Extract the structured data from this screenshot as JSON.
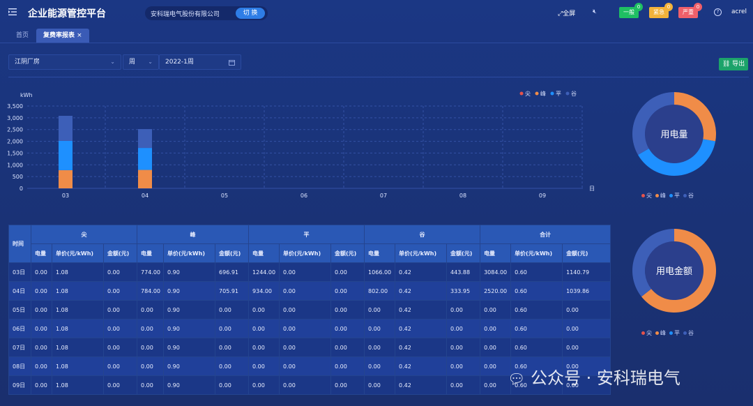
{
  "header": {
    "title": "企业能源管控平台",
    "company": "安科瑞电气股份有限公司",
    "switch_label": "切 换",
    "fullscreen_label": "全屏",
    "badges": [
      {
        "label": "一般",
        "count": "0",
        "color": "#1fbf63",
        "count_color": "#1fbf63"
      },
      {
        "label": "紧急",
        "count": "0",
        "color": "#f2b23a",
        "count_color": "#f2b23a"
      },
      {
        "label": "严重",
        "count": "0",
        "color": "#f0606a",
        "count_color": "#f0606a"
      }
    ],
    "username": "acrel"
  },
  "tabs": [
    {
      "label": "首页",
      "active": false
    },
    {
      "label": "复费率报表",
      "active": true
    }
  ],
  "filters": {
    "site": "江阴厂房",
    "period": "周",
    "date": "2022-1周"
  },
  "export_label": "导出",
  "legend": [
    {
      "name": "尖",
      "color": "#e5534b"
    },
    {
      "name": "峰",
      "color": "#f08c48"
    },
    {
      "name": "平",
      "color": "#1e90ff"
    },
    {
      "name": "谷",
      "color": "#3d5fb8"
    }
  ],
  "chart_data": [
    {
      "type": "bar",
      "stacked": true,
      "title": "",
      "ylabel": "kWh",
      "xlabel": "日",
      "ylim": [
        0,
        3500
      ],
      "yticks": [
        "0",
        "500",
        "1,000",
        "1,500",
        "2,000",
        "2,500",
        "3,000",
        "3,500"
      ],
      "categories": [
        "03",
        "04",
        "05",
        "06",
        "07",
        "08",
        "09"
      ],
      "series": [
        {
          "name": "尖",
          "color": "#e5534b",
          "values": [
            0,
            0,
            0,
            0,
            0,
            0,
            0
          ]
        },
        {
          "name": "峰",
          "color": "#f08c48",
          "values": [
            774,
            784,
            0,
            0,
            0,
            0,
            0
          ]
        },
        {
          "name": "平",
          "color": "#1e90ff",
          "values": [
            1244,
            934,
            0,
            0,
            0,
            0,
            0
          ]
        },
        {
          "name": "谷",
          "color": "#3d5fb8",
          "values": [
            1066,
            802,
            0,
            0,
            0,
            0,
            0
          ]
        }
      ],
      "legend_position": "top-right",
      "grid": true
    },
    {
      "type": "pie",
      "title": "用电量",
      "labels": [
        "尖",
        "峰",
        "平",
        "谷"
      ],
      "values": [
        0,
        1558,
        2178,
        1868
      ],
      "colors": [
        "#e5534b",
        "#f08c48",
        "#1e90ff",
        "#3d5fb8"
      ]
    },
    {
      "type": "pie",
      "title": "用电金额",
      "labels": [
        "尖",
        "峰",
        "平",
        "谷"
      ],
      "values": [
        0,
        1402.82,
        0,
        777.83
      ],
      "colors": [
        "#e5534b",
        "#f08c48",
        "#1e90ff",
        "#3d5fb8"
      ]
    }
  ],
  "table": {
    "time_header": "时间",
    "groups": [
      "尖",
      "峰",
      "平",
      "谷",
      "合计"
    ],
    "sub_headers": [
      "电量",
      "单价(元/kWh)",
      "金额(元)"
    ],
    "rows": [
      [
        "03日",
        "0.00",
        "1.08",
        "0.00",
        "774.00",
        "0.90",
        "696.91",
        "1244.00",
        "0.00",
        "0.00",
        "1066.00",
        "0.42",
        "443.88",
        "3084.00",
        "0.60",
        "1140.79"
      ],
      [
        "04日",
        "0.00",
        "1.08",
        "0.00",
        "784.00",
        "0.90",
        "705.91",
        "934.00",
        "0.00",
        "0.00",
        "802.00",
        "0.42",
        "333.95",
        "2520.00",
        "0.60",
        "1039.86"
      ],
      [
        "05日",
        "0.00",
        "1.08",
        "0.00",
        "0.00",
        "0.90",
        "0.00",
        "0.00",
        "0.00",
        "0.00",
        "0.00",
        "0.42",
        "0.00",
        "0.00",
        "0.60",
        "0.00"
      ],
      [
        "06日",
        "0.00",
        "1.08",
        "0.00",
        "0.00",
        "0.90",
        "0.00",
        "0.00",
        "0.00",
        "0.00",
        "0.00",
        "0.42",
        "0.00",
        "0.00",
        "0.60",
        "0.00"
      ],
      [
        "07日",
        "0.00",
        "1.08",
        "0.00",
        "0.00",
        "0.90",
        "0.00",
        "0.00",
        "0.00",
        "0.00",
        "0.00",
        "0.42",
        "0.00",
        "0.00",
        "0.60",
        "0.00"
      ],
      [
        "08日",
        "0.00",
        "1.08",
        "0.00",
        "0.00",
        "0.90",
        "0.00",
        "0.00",
        "0.00",
        "0.00",
        "0.00",
        "0.42",
        "0.00",
        "0.00",
        "0.60",
        "0.00"
      ],
      [
        "09日",
        "0.00",
        "1.08",
        "0.00",
        "0.00",
        "0.90",
        "0.00",
        "0.00",
        "0.00",
        "0.00",
        "0.00",
        "0.42",
        "0.00",
        "0.00",
        "0.60",
        "0.00"
      ]
    ]
  },
  "watermark": "公众号 · 安科瑞电气"
}
